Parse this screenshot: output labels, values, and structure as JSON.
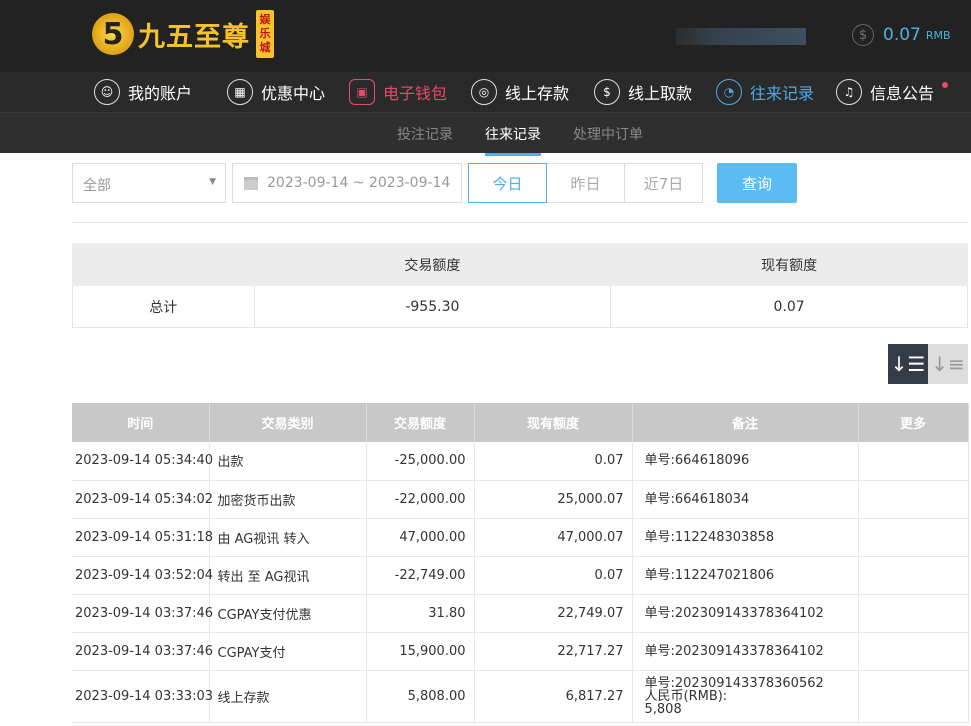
{
  "header": {
    "logo_text": "九五至尊",
    "logo_tag": "娱乐城",
    "balance": "0.07",
    "currency": "RMB"
  },
  "nav": [
    {
      "label": "我的账户",
      "icon": "user-icon"
    },
    {
      "label": "优惠中心",
      "icon": "gift-icon"
    },
    {
      "label": "电子钱包",
      "icon": "wallet-icon"
    },
    {
      "label": "线上存款",
      "icon": "deposit-icon"
    },
    {
      "label": "线上取款",
      "icon": "withdraw-icon"
    },
    {
      "label": "往来记录",
      "icon": "records-icon"
    },
    {
      "label": "信息公告",
      "icon": "bell-icon"
    }
  ],
  "subnav": [
    "投注记录",
    "往来记录",
    "处理中订单"
  ],
  "filter": {
    "type": "全部",
    "date_range": "2023-09-14 ~ 2023-09-14",
    "quick": [
      "今日",
      "昨日",
      "近7日"
    ],
    "query": "查询"
  },
  "summary": {
    "headers": [
      "",
      "交易额度",
      "现有额度"
    ],
    "label": "总计",
    "amount": "-955.30",
    "balance": "0.07"
  },
  "table": {
    "headers": [
      "时间",
      "交易类别",
      "交易额度",
      "现有额度",
      "备注",
      "更多"
    ],
    "rows": [
      {
        "time": "2023-09-14 05:34:40",
        "type": "出款",
        "amount": "-25,000.00",
        "balance": "0.07",
        "note": [
          "单号:664618096"
        ]
      },
      {
        "time": "2023-09-14 05:34:02",
        "type": "加密货币出款",
        "amount": "-22,000.00",
        "balance": "25,000.07",
        "note": [
          "单号:664618034"
        ]
      },
      {
        "time": "2023-09-14 05:31:18",
        "type": "由 AG视讯 转入",
        "amount": "47,000.00",
        "balance": "47,000.07",
        "note": [
          "单号:112248303858"
        ]
      },
      {
        "time": "2023-09-14 03:52:04",
        "type": "转出 至 AG视讯",
        "amount": "-22,749.00",
        "balance": "0.07",
        "note": [
          "单号:112247021806"
        ]
      },
      {
        "time": "2023-09-14 03:37:46",
        "type": "CGPAY支付优惠",
        "amount": "31.80",
        "balance": "22,749.07",
        "note": [
          "单号:202309143378364102"
        ]
      },
      {
        "time": "2023-09-14 03:37:46",
        "type": "CGPAY支付",
        "amount": "15,900.00",
        "balance": "22,717.27",
        "note": [
          "单号:202309143378364102"
        ]
      },
      {
        "time": "2023-09-14 03:33:03",
        "type": "线上存款",
        "amount": "5,808.00",
        "balance": "6,817.27",
        "note": [
          "单号:202309143378360562",
          "人民币(RMB):",
          "5,808"
        ]
      }
    ]
  }
}
